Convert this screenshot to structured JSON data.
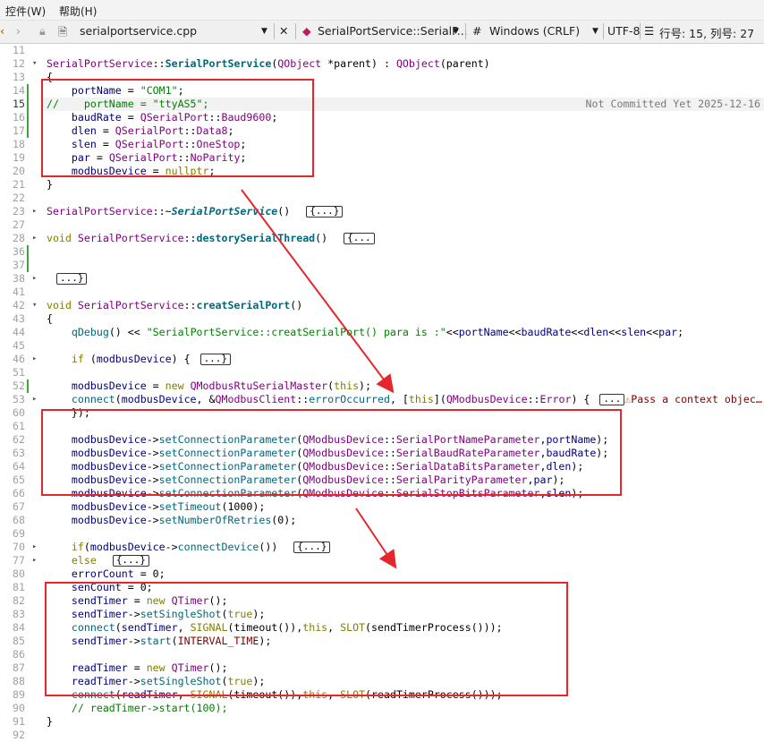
{
  "menubar": {
    "items": [
      "控件(W)",
      "帮助(H)"
    ]
  },
  "toolbar": {
    "filename": "serialportservice.cpp",
    "symbol": "SerialPortService::SerialP...",
    "hash": "#",
    "line_ending": "Windows (CRLF)",
    "encoding": "UTF-8",
    "position": "行号: 15, 列号: 27"
  },
  "blame": "Not Committed Yet 2025-12-16",
  "lines": [
    {
      "n": "11",
      "html": ""
    },
    {
      "n": "12",
      "fold": "▾",
      "html": "<span class='t'>SerialPortService</span><span class='p'>::</span><span class='fnb'>SerialPortService</span><span class='p'>(</span><span class='t'>QObject</span><span class='p'> *parent) : </span><span class='t'>QObject</span><span class='p'>(parent)</span>"
    },
    {
      "n": "13",
      "html": "<span class='p'>{</span>"
    },
    {
      "n": "14",
      "html": "    <span class='n'>portName</span><span class='p'> = </span><span class='s'>\"COM1\"</span><span class='p'>;</span>"
    },
    {
      "n": "15",
      "cur": true,
      "html": "<span class='c'>//    portName = \"ttyAS5\";</span>"
    },
    {
      "n": "16",
      "html": "    <span class='n'>baudRate</span><span class='p'> = </span><span class='t'>QSerialPort</span><span class='p'>::</span><span class='t'>Baud9600</span><span class='p'>;</span>"
    },
    {
      "n": "17",
      "html": "    <span class='n'>dlen</span><span class='p'> = </span><span class='t'>QSerialPort</span><span class='p'>::</span><span class='t'>Data8</span><span class='p'>;</span>"
    },
    {
      "n": "18",
      "html": "    <span class='n'>slen</span><span class='p'> = </span><span class='t'>QSerialPort</span><span class='p'>::</span><span class='t'>OneStop</span><span class='p'>;</span>"
    },
    {
      "n": "19",
      "html": "    <span class='n'>par</span><span class='p'> = </span><span class='t'>QSerialPort</span><span class='p'>::</span><span class='t'>NoParity</span><span class='p'>;</span>"
    },
    {
      "n": "20",
      "html": "    <span class='n'>modbusDevice</span><span class='p'> = </span><span class='k'>nullptr</span><span class='p'>;</span>"
    },
    {
      "n": "21",
      "html": "<span class='p'>}</span>"
    },
    {
      "n": "22",
      "html": ""
    },
    {
      "n": "23",
      "fold": "▸",
      "html": "<span class='t'>SerialPortService</span><span class='p'>::~</span><span class='fni'>SerialPortService</span><span class='p'>()</span>  <span class='collapsed'>{...}</span>"
    },
    {
      "n": "27",
      "html": ""
    },
    {
      "n": "28",
      "fold": "▸",
      "html": "<span class='k'>void</span><span class='p'> </span><span class='t'>SerialPortService</span><span class='p'>::</span><span class='fnb'>destorySerialThread</span><span class='p'>()</span>  <span class='collapsed'>{...</span>"
    },
    {
      "n": "36",
      "html": ""
    },
    {
      "n": "37",
      "html": ""
    },
    {
      "n": "38",
      "fold": "▸",
      "html": " <span class='collapsed'>...}</span>"
    },
    {
      "n": "41",
      "html": ""
    },
    {
      "n": "42",
      "fold": "▾",
      "html": "<span class='k'>void</span><span class='p'> </span><span class='t'>SerialPortService</span><span class='p'>::</span><span class='fnb'>creatSerialPort</span><span class='p'>()</span>"
    },
    {
      "n": "43",
      "html": "<span class='p'>{</span>"
    },
    {
      "n": "44",
      "html": "    <span class='fn'>qDebug</span><span class='p'>() &lt;&lt; </span><span class='s'>\"SerialPortService::creatSerialPort() para is :\"</span><span class='p'>&lt;&lt;</span><span class='n'>portName</span><span class='p'>&lt;&lt;</span><span class='n'>baudRate</span><span class='p'>&lt;&lt;</span><span class='n'>dlen</span><span class='p'>&lt;&lt;</span><span class='n'>slen</span><span class='p'>&lt;&lt;</span><span class='n'>par</span><span class='p'>;</span>"
    },
    {
      "n": "45",
      "html": ""
    },
    {
      "n": "46",
      "fold": "▸",
      "html": "    <span class='k'>if</span><span class='p'> (</span><span class='n'>modbusDevice</span><span class='p'>) {</span> <span class='collapsed'>...}</span>"
    },
    {
      "n": "51",
      "html": ""
    },
    {
      "n": "52",
      "html": "    <span class='n'>modbusDevice</span><span class='p'> = </span><span class='k'>new</span><span class='p'> </span><span class='t'>QModbusRtuSerialMaster</span><span class='p'>(</span><span class='k'>this</span><span class='p'>);</span>"
    },
    {
      "n": "53",
      "fold": "▸",
      "warn": true,
      "html": "    <span class='fn'>connect</span><span class='p'>(</span><span class='n'>modbusDevice</span><span class='p'>, &amp;</span><span class='t'>QModbusClient</span><span class='p'>::</span><span class='fn'>errorOccurred</span><span class='p'>, [</span><span class='k'>this</span><span class='p'>](</span><span class='t'>QModbusDevice</span><span class='p'>::</span><span class='t'>Error</span><span class='p'>) {</span> <span class='collapsed'>...</span><span class='warn'>⚠</span><span class='m'>Pass a context objec…</span>"
    },
    {
      "n": "60",
      "html": "    <span class='p'>});</span>"
    },
    {
      "n": "61",
      "html": ""
    },
    {
      "n": "62",
      "html": "    <span class='n'>modbusDevice</span><span class='p'>-&gt;</span><span class='fn'>setConnectionParameter</span><span class='p'>(</span><span class='t'>QModbusDevice</span><span class='p'>::</span><span class='t'>SerialPortNameParameter</span><span class='p'>,</span><span class='n'>portName</span><span class='p'>);</span>"
    },
    {
      "n": "63",
      "html": "    <span class='n'>modbusDevice</span><span class='p'>-&gt;</span><span class='fn'>setConnectionParameter</span><span class='p'>(</span><span class='t'>QModbusDevice</span><span class='p'>::</span><span class='t'>SerialBaudRateParameter</span><span class='p'>,</span><span class='n'>baudRate</span><span class='p'>);</span>"
    },
    {
      "n": "64",
      "html": "    <span class='n'>modbusDevice</span><span class='p'>-&gt;</span><span class='fn'>setConnectionParameter</span><span class='p'>(</span><span class='t'>QModbusDevice</span><span class='p'>::</span><span class='t'>SerialDataBitsParameter</span><span class='p'>,</span><span class='n'>dlen</span><span class='p'>);</span>"
    },
    {
      "n": "65",
      "html": "    <span class='n'>modbusDevice</span><span class='p'>-&gt;</span><span class='fn'>setConnectionParameter</span><span class='p'>(</span><span class='t'>QModbusDevice</span><span class='p'>::</span><span class='t'>SerialParityParameter</span><span class='p'>,</span><span class='n'>par</span><span class='p'>);</span>"
    },
    {
      "n": "66",
      "html": "    <span class='n'>modbusDevice</span><span class='p'>-&gt;</span><span class='fn'>setConnectionParameter</span><span class='p'>(</span><span class='t'>QModbusDevice</span><span class='p'>::</span><span class='t'>SerialStopBitsParameter</span><span class='p'>,</span><span class='n'>slen</span><span class='p'>);</span>"
    },
    {
      "n": "67",
      "html": "    <span class='n'>modbusDevice</span><span class='p'>-&gt;</span><span class='fn'>setTimeout</span><span class='p'>(1000);</span>"
    },
    {
      "n": "68",
      "html": "    <span class='n'>modbusDevice</span><span class='p'>-&gt;</span><span class='fn'>setNumberOfRetries</span><span class='p'>(0);</span>"
    },
    {
      "n": "69",
      "html": ""
    },
    {
      "n": "70",
      "fold": "▸",
      "html": "    <span class='k'>if</span><span class='p'>(</span><span class='n'>modbusDevice</span><span class='p'>-&gt;</span><span class='fn'>connectDevice</span><span class='p'>())</span>  <span class='collapsed'>{...}</span>"
    },
    {
      "n": "77",
      "fold": "▸",
      "html": "    <span class='k'>else</span>  <span class='collapsed'>{...}</span>"
    },
    {
      "n": "80",
      "html": "    <span class='n'>errorCount</span><span class='p'> = 0;</span>"
    },
    {
      "n": "81",
      "html": "    <span class='n'>senCount</span><span class='p'> = 0;</span>"
    },
    {
      "n": "82",
      "html": "    <span class='n'>sendTimer</span><span class='p'> = </span><span class='k'>new</span><span class='p'> </span><span class='t'>QTimer</span><span class='p'>();</span>"
    },
    {
      "n": "83",
      "html": "    <span class='n'>sendTimer</span><span class='p'>-&gt;</span><span class='fn'>setSingleShot</span><span class='p'>(</span><span class='k'>true</span><span class='p'>);</span>"
    },
    {
      "n": "84",
      "html": "    <span class='fn'>connect</span><span class='p'>(</span><span class='n'>sendTimer</span><span class='p'>, </span><span class='k'>SIGNAL</span><span class='p'>(timeout()),</span><span class='k'>this</span><span class='p'>, </span><span class='k'>SLOT</span><span class='p'>(sendTimerProcess()));</span>"
    },
    {
      "n": "85",
      "html": "    <span class='n'>sendTimer</span><span class='p'>-&gt;</span><span class='fn'>start</span><span class='p'>(</span><span class='m'>INTERVAL_TIME</span><span class='p'>);</span>"
    },
    {
      "n": "86",
      "html": ""
    },
    {
      "n": "87",
      "html": "    <span class='n'>readTimer</span><span class='p'> = </span><span class='k'>new</span><span class='p'> </span><span class='t'>QTimer</span><span class='p'>();</span>"
    },
    {
      "n": "88",
      "html": "    <span class='n'>readTimer</span><span class='p'>-&gt;</span><span class='fn'>setSingleShot</span><span class='p'>(</span><span class='k'>true</span><span class='p'>);</span>"
    },
    {
      "n": "89",
      "html": "    <span class='fn'>connect</span><span class='p'>(</span><span class='n'>readTimer</span><span class='p'>, </span><span class='k'>SIGNAL</span><span class='p'>(timeout()),</span><span class='k'>this</span><span class='p'>, </span><span class='k'>SLOT</span><span class='p'>(readTimerProcess()));</span>"
    },
    {
      "n": "90",
      "html": "    <span class='c'>// readTimer->start(100);</span>"
    },
    {
      "n": "91",
      "html": "<span class='p'>}</span>"
    },
    {
      "n": "92",
      "html": ""
    }
  ]
}
